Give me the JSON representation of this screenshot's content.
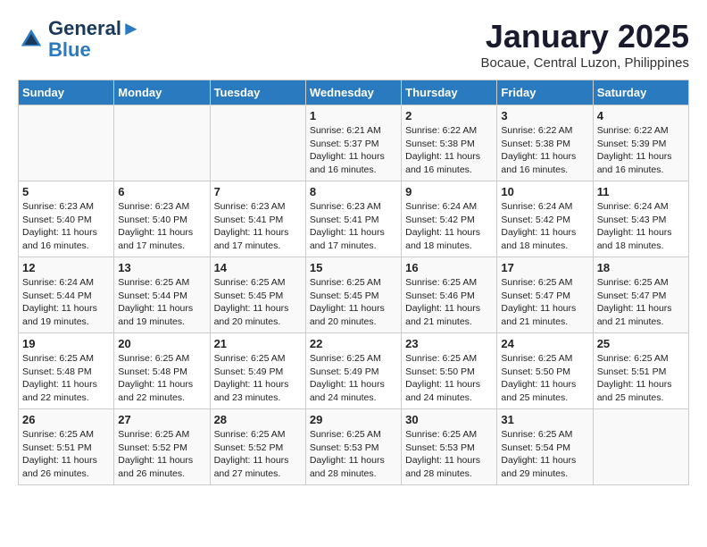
{
  "header": {
    "logo_line1": "General",
    "logo_line2": "Blue",
    "month": "January 2025",
    "location": "Bocaue, Central Luzon, Philippines"
  },
  "weekdays": [
    "Sunday",
    "Monday",
    "Tuesday",
    "Wednesday",
    "Thursday",
    "Friday",
    "Saturday"
  ],
  "weeks": [
    [
      {
        "day": "",
        "info": ""
      },
      {
        "day": "",
        "info": ""
      },
      {
        "day": "",
        "info": ""
      },
      {
        "day": "1",
        "info": "Sunrise: 6:21 AM\nSunset: 5:37 PM\nDaylight: 11 hours and 16 minutes."
      },
      {
        "day": "2",
        "info": "Sunrise: 6:22 AM\nSunset: 5:38 PM\nDaylight: 11 hours and 16 minutes."
      },
      {
        "day": "3",
        "info": "Sunrise: 6:22 AM\nSunset: 5:38 PM\nDaylight: 11 hours and 16 minutes."
      },
      {
        "day": "4",
        "info": "Sunrise: 6:22 AM\nSunset: 5:39 PM\nDaylight: 11 hours and 16 minutes."
      }
    ],
    [
      {
        "day": "5",
        "info": "Sunrise: 6:23 AM\nSunset: 5:40 PM\nDaylight: 11 hours and 16 minutes."
      },
      {
        "day": "6",
        "info": "Sunrise: 6:23 AM\nSunset: 5:40 PM\nDaylight: 11 hours and 17 minutes."
      },
      {
        "day": "7",
        "info": "Sunrise: 6:23 AM\nSunset: 5:41 PM\nDaylight: 11 hours and 17 minutes."
      },
      {
        "day": "8",
        "info": "Sunrise: 6:23 AM\nSunset: 5:41 PM\nDaylight: 11 hours and 17 minutes."
      },
      {
        "day": "9",
        "info": "Sunrise: 6:24 AM\nSunset: 5:42 PM\nDaylight: 11 hours and 18 minutes."
      },
      {
        "day": "10",
        "info": "Sunrise: 6:24 AM\nSunset: 5:42 PM\nDaylight: 11 hours and 18 minutes."
      },
      {
        "day": "11",
        "info": "Sunrise: 6:24 AM\nSunset: 5:43 PM\nDaylight: 11 hours and 18 minutes."
      }
    ],
    [
      {
        "day": "12",
        "info": "Sunrise: 6:24 AM\nSunset: 5:44 PM\nDaylight: 11 hours and 19 minutes."
      },
      {
        "day": "13",
        "info": "Sunrise: 6:25 AM\nSunset: 5:44 PM\nDaylight: 11 hours and 19 minutes."
      },
      {
        "day": "14",
        "info": "Sunrise: 6:25 AM\nSunset: 5:45 PM\nDaylight: 11 hours and 20 minutes."
      },
      {
        "day": "15",
        "info": "Sunrise: 6:25 AM\nSunset: 5:45 PM\nDaylight: 11 hours and 20 minutes."
      },
      {
        "day": "16",
        "info": "Sunrise: 6:25 AM\nSunset: 5:46 PM\nDaylight: 11 hours and 21 minutes."
      },
      {
        "day": "17",
        "info": "Sunrise: 6:25 AM\nSunset: 5:47 PM\nDaylight: 11 hours and 21 minutes."
      },
      {
        "day": "18",
        "info": "Sunrise: 6:25 AM\nSunset: 5:47 PM\nDaylight: 11 hours and 21 minutes."
      }
    ],
    [
      {
        "day": "19",
        "info": "Sunrise: 6:25 AM\nSunset: 5:48 PM\nDaylight: 11 hours and 22 minutes."
      },
      {
        "day": "20",
        "info": "Sunrise: 6:25 AM\nSunset: 5:48 PM\nDaylight: 11 hours and 22 minutes."
      },
      {
        "day": "21",
        "info": "Sunrise: 6:25 AM\nSunset: 5:49 PM\nDaylight: 11 hours and 23 minutes."
      },
      {
        "day": "22",
        "info": "Sunrise: 6:25 AM\nSunset: 5:49 PM\nDaylight: 11 hours and 24 minutes."
      },
      {
        "day": "23",
        "info": "Sunrise: 6:25 AM\nSunset: 5:50 PM\nDaylight: 11 hours and 24 minutes."
      },
      {
        "day": "24",
        "info": "Sunrise: 6:25 AM\nSunset: 5:50 PM\nDaylight: 11 hours and 25 minutes."
      },
      {
        "day": "25",
        "info": "Sunrise: 6:25 AM\nSunset: 5:51 PM\nDaylight: 11 hours and 25 minutes."
      }
    ],
    [
      {
        "day": "26",
        "info": "Sunrise: 6:25 AM\nSunset: 5:51 PM\nDaylight: 11 hours and 26 minutes."
      },
      {
        "day": "27",
        "info": "Sunrise: 6:25 AM\nSunset: 5:52 PM\nDaylight: 11 hours and 26 minutes."
      },
      {
        "day": "28",
        "info": "Sunrise: 6:25 AM\nSunset: 5:52 PM\nDaylight: 11 hours and 27 minutes."
      },
      {
        "day": "29",
        "info": "Sunrise: 6:25 AM\nSunset: 5:53 PM\nDaylight: 11 hours and 28 minutes."
      },
      {
        "day": "30",
        "info": "Sunrise: 6:25 AM\nSunset: 5:53 PM\nDaylight: 11 hours and 28 minutes."
      },
      {
        "day": "31",
        "info": "Sunrise: 6:25 AM\nSunset: 5:54 PM\nDaylight: 11 hours and 29 minutes."
      },
      {
        "day": "",
        "info": ""
      }
    ]
  ]
}
